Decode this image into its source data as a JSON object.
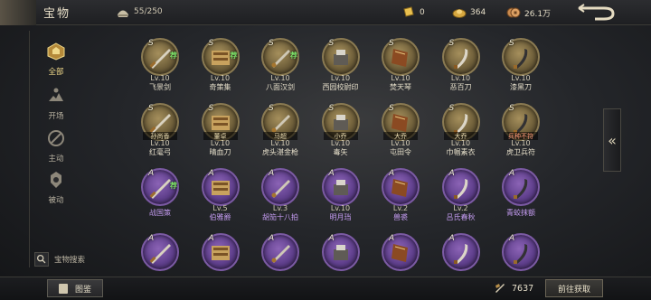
{
  "header": {
    "title": "宝物",
    "capacity": "55/250",
    "resources": [
      {
        "icon": "gold-bar-icon",
        "value": "0"
      },
      {
        "icon": "gold-ingot-icon",
        "value": "364"
      },
      {
        "icon": "copper-coin-icon",
        "value": "26.1万"
      }
    ]
  },
  "sidebar": {
    "items": [
      {
        "label": "全部",
        "icon": "all-icon",
        "active": true
      },
      {
        "label": "开场",
        "icon": "opening-icon",
        "active": false
      },
      {
        "label": "主动",
        "icon": "active-skill-icon",
        "active": false
      },
      {
        "label": "被动",
        "icon": "passive-skill-icon",
        "active": false
      }
    ],
    "search_label": "宝物搜索"
  },
  "treasures": [
    {
      "grade": "S",
      "level": "Lv.10",
      "name": "飞景剑",
      "recommended": "荐",
      "tag": ""
    },
    {
      "grade": "S",
      "level": "Lv.10",
      "name": "奇策集",
      "recommended": "荐",
      "tag": ""
    },
    {
      "grade": "S",
      "level": "Lv.10",
      "name": "八面汉剑",
      "recommended": "荐",
      "tag": ""
    },
    {
      "grade": "S",
      "level": "Lv.10",
      "name": "西园校尉印",
      "recommended": "",
      "tag": ""
    },
    {
      "grade": "S",
      "level": "Lv.10",
      "name": "焚天琴",
      "recommended": "",
      "tag": ""
    },
    {
      "grade": "S",
      "level": "Lv.10",
      "name": "恶百刀",
      "recommended": "",
      "tag": ""
    },
    {
      "grade": "S",
      "level": "Lv.10",
      "name": "漆黑刀",
      "recommended": "",
      "tag": ""
    },
    {
      "grade": "S",
      "level": "Lv.10",
      "name": "红毫弓",
      "recommended": "",
      "tag": "孙尚香"
    },
    {
      "grade": "S",
      "level": "Lv.10",
      "name": "晴血刀",
      "recommended": "",
      "tag": "董卓"
    },
    {
      "grade": "S",
      "level": "Lv.10",
      "name": "虎头湛金枪",
      "recommended": "",
      "tag": "马超"
    },
    {
      "grade": "S",
      "level": "Lv.10",
      "name": "毒矢",
      "recommended": "",
      "tag": "小乔"
    },
    {
      "grade": "S",
      "level": "Lv.10",
      "name": "屯田令",
      "recommended": "",
      "tag": "大乔"
    },
    {
      "grade": "S",
      "level": "Lv.10",
      "name": "巾帼素衣",
      "recommended": "",
      "tag": "大乔"
    },
    {
      "grade": "S",
      "level": "Lv.10",
      "name": "虎卫兵符",
      "recommended": "",
      "tag": "兵种不符"
    },
    {
      "grade": "A",
      "level": "",
      "name": "战国策",
      "recommended": "荐",
      "tag": ""
    },
    {
      "grade": "A",
      "level": "Lv.5",
      "name": "伯雅爵",
      "recommended": "",
      "tag": ""
    },
    {
      "grade": "A",
      "level": "Lv.3",
      "name": "胡笳十八拍",
      "recommended": "",
      "tag": ""
    },
    {
      "grade": "A",
      "level": "Lv.10",
      "name": "明月珰",
      "recommended": "",
      "tag": ""
    },
    {
      "grade": "A",
      "level": "Lv.2",
      "name": "兽裘",
      "recommended": "",
      "tag": ""
    },
    {
      "grade": "A",
      "level": "Lv.2",
      "name": "吕氏春秋",
      "recommended": "",
      "tag": ""
    },
    {
      "grade": "A",
      "level": "",
      "name": "青蛟抹额",
      "recommended": "",
      "tag": ""
    },
    {
      "grade": "A",
      "level": "",
      "name": "",
      "recommended": "",
      "tag": ""
    },
    {
      "grade": "A",
      "level": "",
      "name": "",
      "recommended": "",
      "tag": ""
    },
    {
      "grade": "A",
      "level": "",
      "name": "",
      "recommended": "",
      "tag": ""
    },
    {
      "grade": "A",
      "level": "",
      "name": "",
      "recommended": "",
      "tag": ""
    },
    {
      "grade": "A",
      "level": "",
      "name": "",
      "recommended": "",
      "tag": ""
    },
    {
      "grade": "A",
      "level": "",
      "name": "",
      "recommended": "",
      "tag": ""
    },
    {
      "grade": "A",
      "level": "",
      "name": "",
      "recommended": "",
      "tag": ""
    }
  ],
  "side_tab_glyph": "«",
  "footer": {
    "codex_label": "图鉴",
    "token_count": "7637",
    "acquire_label": "前往获取"
  },
  "colors": {
    "s_grade": "#8a7a52",
    "a_grade": "#7b5aa3",
    "a_name": "#c59cf2",
    "recommend": "#7fe26a",
    "active_tab": "#f0d98a"
  }
}
